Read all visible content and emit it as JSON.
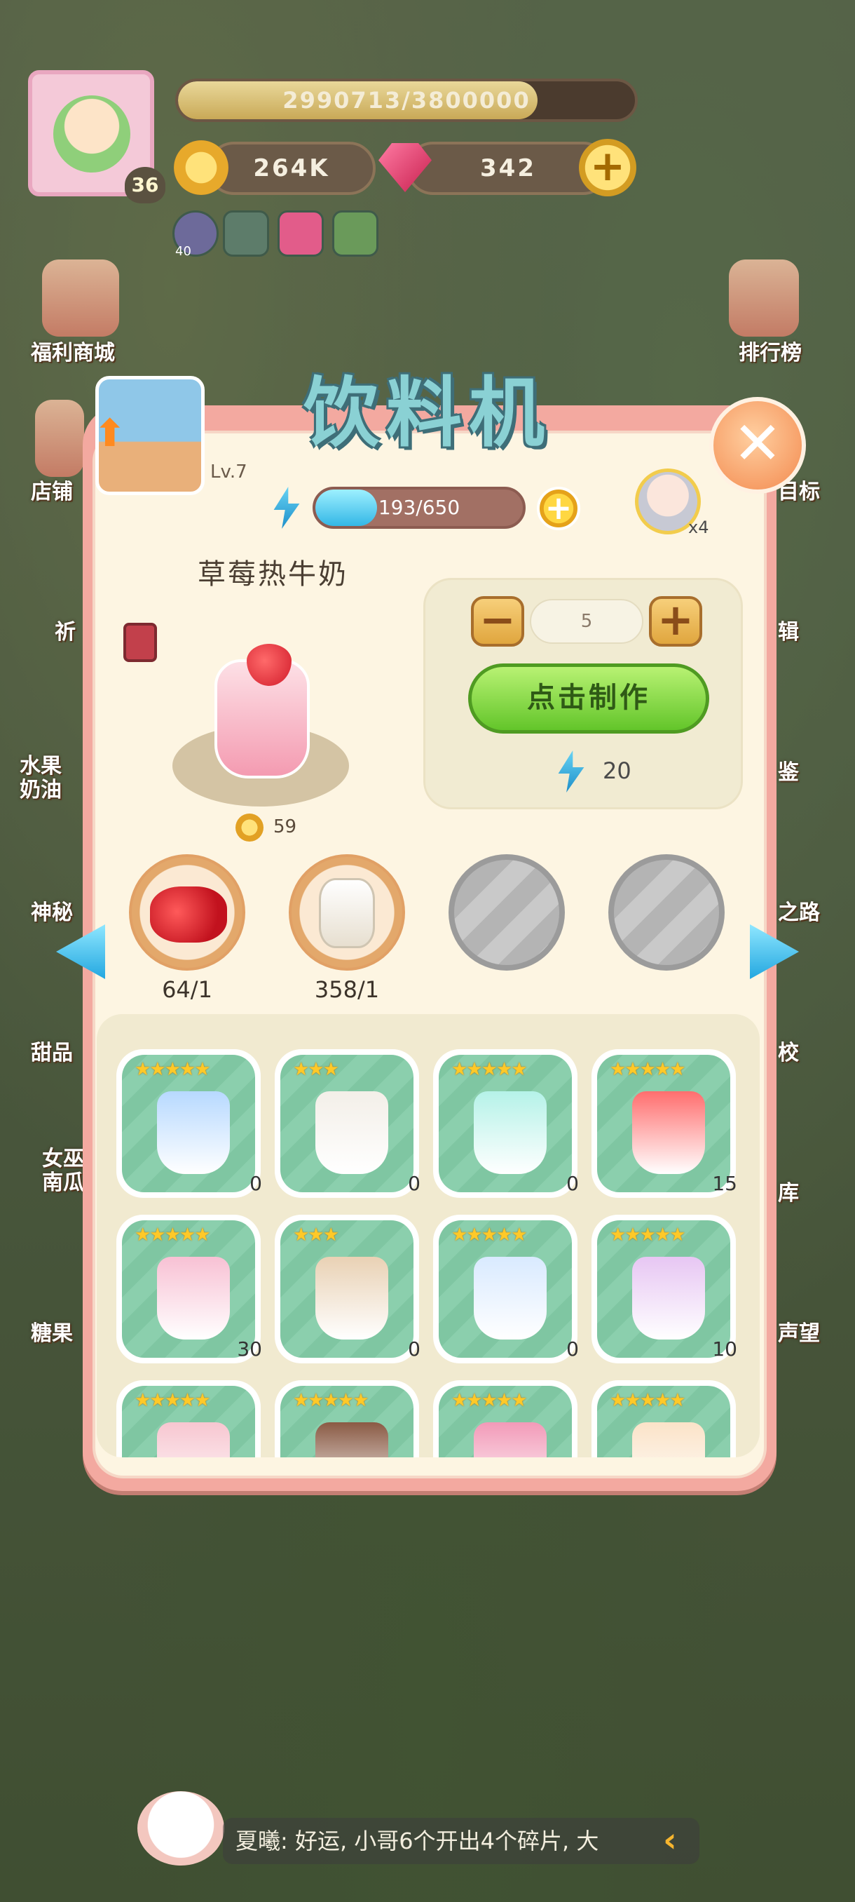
{
  "hud": {
    "xp_text": "2990713/3800000",
    "xp_fraction": 0.787,
    "player_level": "36",
    "coins": "264K",
    "gems": "342",
    "small_badge": "40"
  },
  "side_menu_left": [
    "福利商城",
    "店铺",
    "祈",
    "水果\n奶油",
    "神秘",
    "甜品",
    "女巫\n南瓜",
    "糖果"
  ],
  "side_menu_right": [
    "排行榜",
    "目标",
    "辑",
    "鉴",
    "之路",
    "校",
    "库",
    "声望"
  ],
  "panel": {
    "title": "饮料机",
    "level": "Lv.7",
    "energy_text": "193/650",
    "energy_fraction": 0.297,
    "helper_count": "x4",
    "product_name": "草莓热牛奶",
    "price": "59",
    "quantity": "5",
    "make_label": "点击制作",
    "energy_cost": "20",
    "ingredients": [
      {
        "icon": "strawberry-icon",
        "count": "64/1"
      },
      {
        "icon": "milk-jar-icon",
        "count": "358/1"
      },
      {
        "icon": "empty-slot",
        "count": ""
      },
      {
        "icon": "empty-slot",
        "count": ""
      }
    ],
    "drinks": [
      {
        "stars": "★★★★★",
        "qty": "0",
        "color": "#b7d9ff"
      },
      {
        "stars": "★★★",
        "qty": "0",
        "color": "#f3efe8"
      },
      {
        "stars": "★★★★★",
        "qty": "0",
        "color": "#b5f2e8"
      },
      {
        "stars": "★★★★★",
        "qty": "15",
        "color": "#ff6e6e"
      },
      {
        "stars": "★★★★★",
        "qty": "30",
        "color": "#f8c1d4"
      },
      {
        "stars": "★★★",
        "qty": "0",
        "color": "#e9d1b4"
      },
      {
        "stars": "★★★★★",
        "qty": "0",
        "color": "#d9eaff"
      },
      {
        "stars": "★★★★★",
        "qty": "10",
        "color": "#e7c6f3"
      },
      {
        "stars": "★★★★★",
        "qty": "",
        "color": "#f7c6d0"
      },
      {
        "stars": "★★★★★",
        "qty": "",
        "color": "#8a5a44"
      },
      {
        "stars": "★★★★★",
        "qty": "",
        "color": "#f29ab8"
      },
      {
        "stars": "★★★★★",
        "qty": "",
        "color": "#fbe3c8"
      }
    ]
  },
  "chat": {
    "message": "夏曦: 好运, 小哥6个开出4个碎片, 大"
  }
}
